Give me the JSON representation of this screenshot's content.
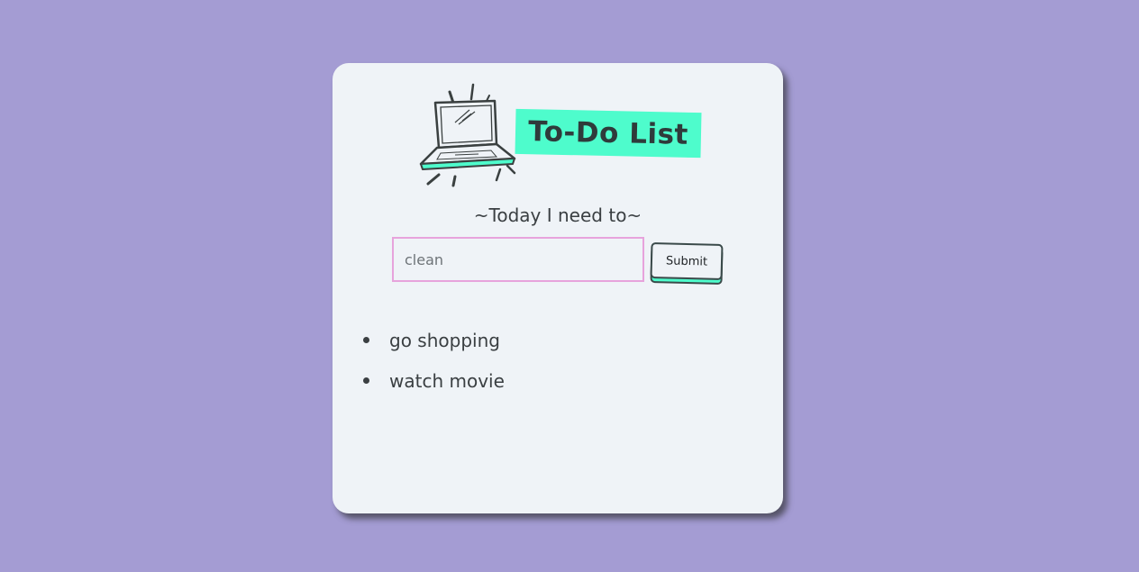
{
  "header": {
    "title": "To-Do List",
    "subtitle": "~Today I need to~",
    "illustration_icon": "laptop-sketch-icon"
  },
  "form": {
    "input_value": "clean",
    "submit_label": "Submit"
  },
  "todos": [
    {
      "text": "go shopping"
    },
    {
      "text": "watch movie"
    }
  ],
  "colors": {
    "background": "#a49cd3",
    "card": "#eff3f7",
    "accent": "#4efccc",
    "input_border": "#e7a3dc",
    "text": "#3a3f42"
  }
}
